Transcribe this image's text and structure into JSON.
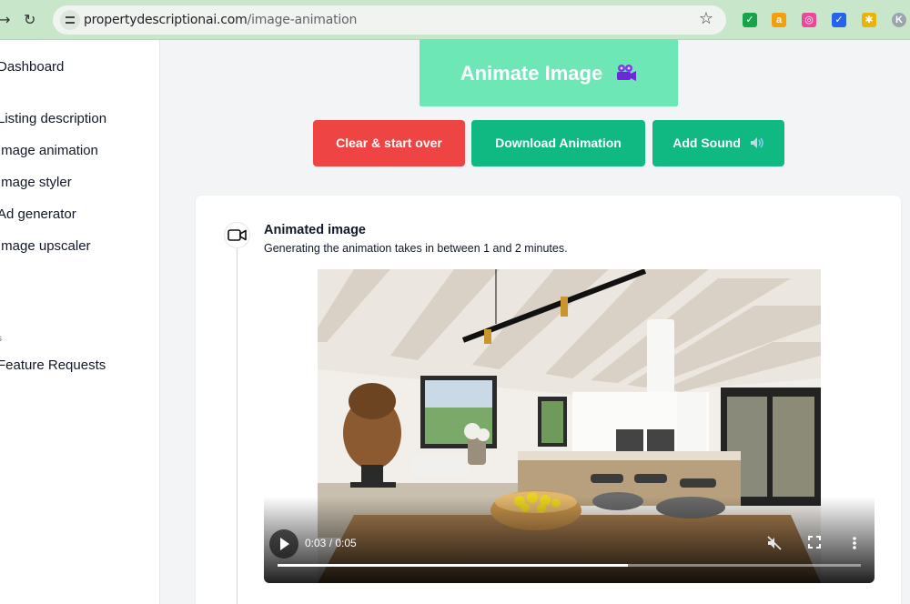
{
  "browser": {
    "url_host": "propertydescriptionai.com",
    "url_path": "/image-animation",
    "back_icon": "arrow-right-icon",
    "reload_icon": "reload-icon",
    "bookmark_icon": "star-icon",
    "extensions": [
      {
        "name": "green-check-extension-icon",
        "color": "#16a34a",
        "glyph": "✓"
      },
      {
        "name": "amazon-extension-icon",
        "color": "#f59e0b",
        "glyph": "a"
      },
      {
        "name": "camera-extension-icon",
        "color": "#ec4899",
        "glyph": "◎"
      },
      {
        "name": "blue-check-extension-icon",
        "color": "#2563eb",
        "glyph": "✓"
      },
      {
        "name": "puzzle-extension-icon",
        "color": "#eab308",
        "glyph": "✱"
      },
      {
        "name": "profile-avatar-icon",
        "color": "#9ca3af",
        "glyph": "K"
      }
    ]
  },
  "sidebar": {
    "items": [
      {
        "label": "Dashboard"
      },
      {
        "label": "Listing description"
      },
      {
        "label": "Image animation"
      },
      {
        "label": "Image styler"
      },
      {
        "label": "Ad generator"
      },
      {
        "label": "Image upscaler"
      }
    ],
    "group_label": "s",
    "feature_requests": "Feature Requests"
  },
  "actions": {
    "animate_label": "Animate Image",
    "animate_icon": "movie-camera-icon",
    "clear_label": "Clear & start over",
    "download_label": "Download Animation",
    "sound_label": "Add Sound",
    "sound_icon": "speaker-icon",
    "colors": {
      "animate": "#6ee7b7",
      "clear": "#ef4444",
      "primary": "#10b981"
    }
  },
  "result": {
    "step_icon": "video-camera-icon",
    "title": "Animated image",
    "subtitle": "Generating the animation takes in between 1 and 2 minutes."
  },
  "video": {
    "time": "0:03 / 0:05",
    "progress_fraction": 0.6,
    "play_icon": "play-icon",
    "mute_icon": "muted-speaker-icon",
    "fullscreen_icon": "fullscreen-icon",
    "more_icon": "more-vertical-icon"
  }
}
